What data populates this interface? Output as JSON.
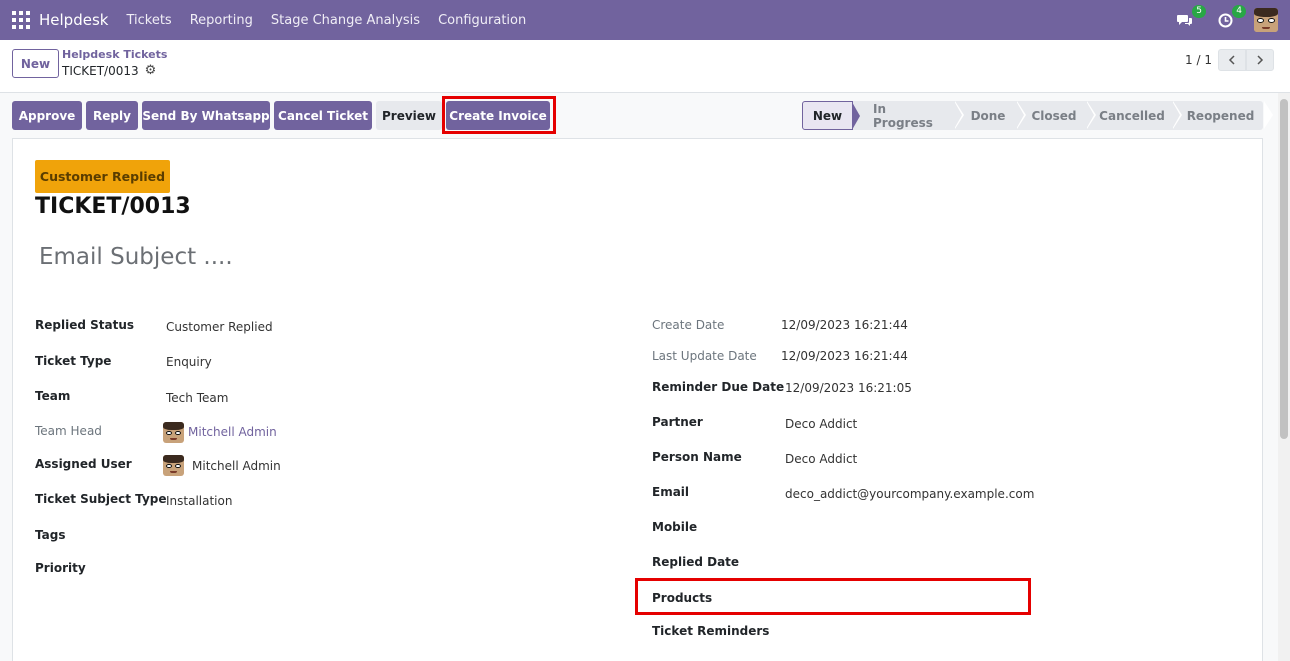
{
  "navbar": {
    "brand": "Helpdesk",
    "menu": [
      "Tickets",
      "Reporting",
      "Stage Change Analysis",
      "Configuration"
    ],
    "messages_badge": "5",
    "activities_badge": "4",
    "icons": [
      "apps-grid-icon",
      "chat-icon",
      "clock-icon",
      "user-avatar"
    ]
  },
  "control": {
    "new_label": "New",
    "breadcrumb_parent": "Helpdesk Tickets",
    "breadcrumb_current": "TICKET/0013",
    "pager": "1 / 1"
  },
  "actions": {
    "approve": "Approve",
    "reply": "Reply",
    "send_whatsapp": "Send By Whatsapp",
    "cancel_ticket": "Cancel Ticket",
    "preview": "Preview",
    "create_invoice": "Create Invoice"
  },
  "stages": [
    "New",
    "In Progress",
    "Done",
    "Closed",
    "Cancelled",
    "Reopened"
  ],
  "active_stage": "New",
  "form": {
    "ribbon": "Customer Replied",
    "title": "TICKET/0013",
    "subject_placeholder": "Email Subject ....",
    "left": {
      "replied_status_label": "Replied Status",
      "replied_status_value": "Customer Replied",
      "ticket_type_label": "Ticket Type",
      "ticket_type_value": "Enquiry",
      "team_label": "Team",
      "team_value": "Tech Team",
      "team_head_label": "Team Head",
      "team_head_value": "Mitchell Admin",
      "assigned_user_label": "Assigned User",
      "assigned_user_value": "Mitchell Admin",
      "subject_type_label": "Ticket Subject Type",
      "subject_type_value": "Installation",
      "tags_label": "Tags",
      "priority_label": "Priority"
    },
    "right": {
      "create_date_label": "Create Date",
      "create_date_value": "12/09/2023 16:21:44",
      "last_update_label": "Last Update Date",
      "last_update_value": "12/09/2023 16:21:44",
      "reminder_due_label": "Reminder Due Date",
      "reminder_due_value": "12/09/2023 16:21:05",
      "partner_label": "Partner",
      "partner_value": "Deco Addict",
      "person_name_label": "Person Name",
      "person_name_value": "Deco Addict",
      "email_label": "Email",
      "email_value": "deco_addict@yourcompany.example.com",
      "mobile_label": "Mobile",
      "replied_date_label": "Replied Date",
      "products_label": "Products",
      "reminders_label": "Ticket Reminders"
    }
  },
  "colors": {
    "brand": "#71639e",
    "ribbon": "#f0a30a",
    "highlight": "#e50000"
  }
}
